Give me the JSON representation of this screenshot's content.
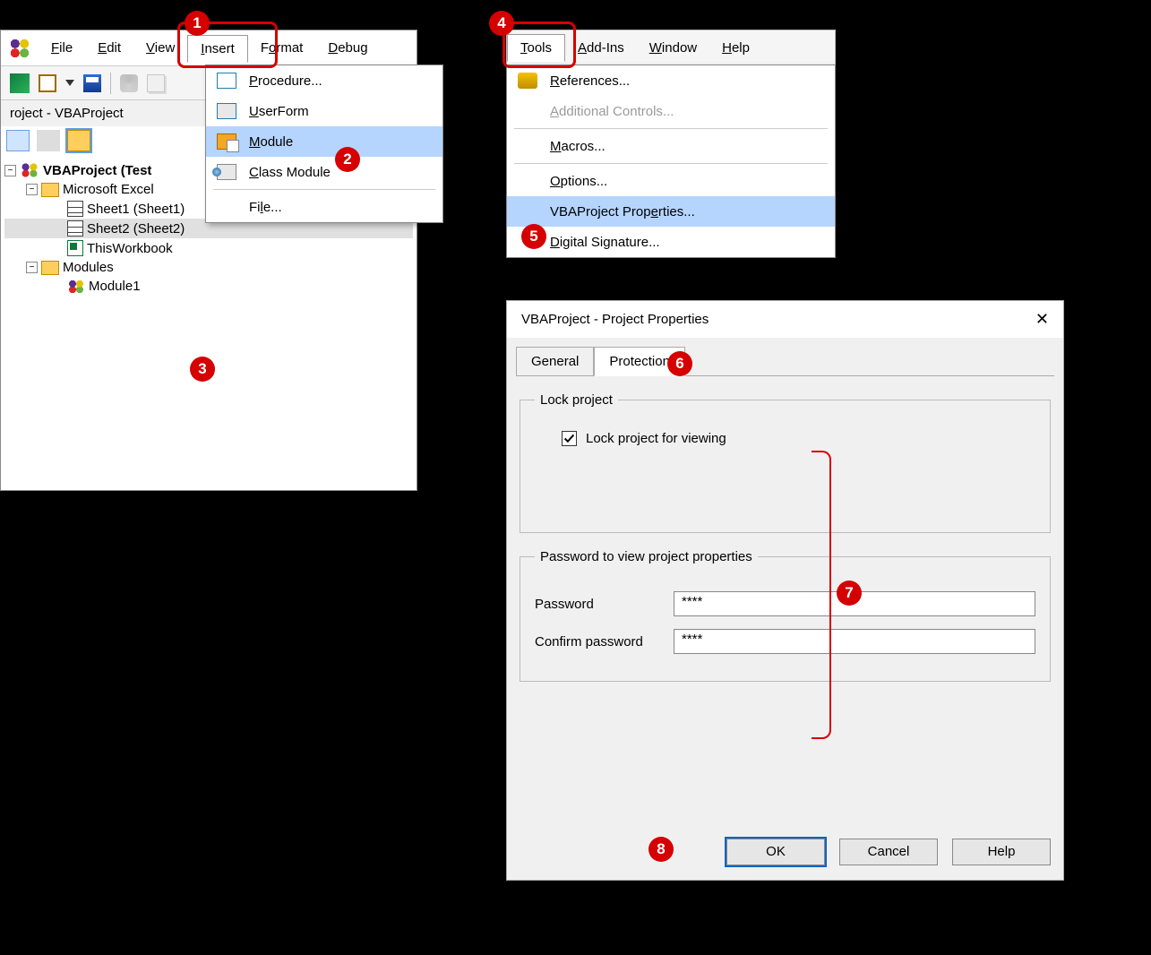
{
  "menu": {
    "file": "File",
    "edit": "Edit",
    "view": "View",
    "insert": "Insert",
    "format": "Format",
    "debug": "Debug",
    "tools": "Tools",
    "addins": "Add-Ins",
    "window": "Window",
    "help": "Help"
  },
  "project_panel": {
    "title": "roject - VBAProject"
  },
  "tree": {
    "root": "VBAProject (Test",
    "excel": "Microsoft Excel",
    "sheet1": "Sheet1 (Sheet1)",
    "sheet2": "Sheet2 (Sheet2)",
    "wb": "ThisWorkbook",
    "modules": "Modules",
    "mod1": "Module1"
  },
  "insert_menu": {
    "procedure": "Procedure...",
    "userform": "UserForm",
    "module": "Module",
    "classmod": "Class Module",
    "file": "File..."
  },
  "tools_menu": {
    "references": "References...",
    "addctrl": "Additional Controls...",
    "macros": "Macros...",
    "options": "Options...",
    "props": "VBAProject Properties...",
    "sig": "Digital Signature..."
  },
  "dialog": {
    "title": "VBAProject - Project Properties",
    "tab_general": "General",
    "tab_protection": "Protection",
    "grp_lock": "Lock project",
    "lock_chk": "Lock project for viewing",
    "grp_pw": "Password to view project properties",
    "pw_lbl": "Password",
    "pw_val": "****",
    "cpw_lbl": "Confirm password",
    "cpw_val": "****",
    "ok": "OK",
    "cancel": "Cancel",
    "help": "Help"
  },
  "callouts": {
    "1": "1",
    "2": "2",
    "3": "3",
    "4": "4",
    "5": "5",
    "6": "6",
    "7": "7",
    "8": "8"
  }
}
